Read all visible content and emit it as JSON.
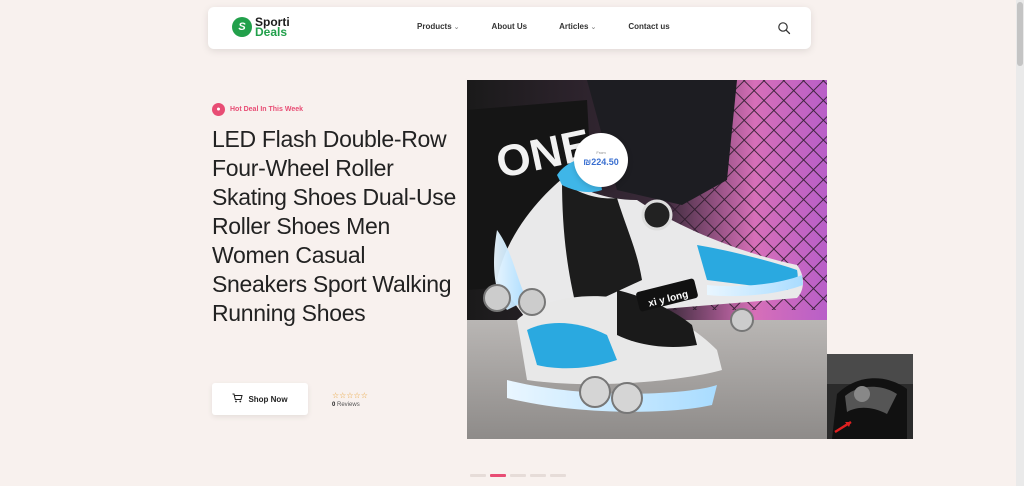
{
  "logo": {
    "line1": "Sporti",
    "line2": "Deals",
    "mark": "S"
  },
  "nav": {
    "items": [
      {
        "label": "Products",
        "dropdown": true
      },
      {
        "label": "About Us",
        "dropdown": false
      },
      {
        "label": "Articles",
        "dropdown": true
      },
      {
        "label": "Contact us",
        "dropdown": false
      }
    ],
    "search_icon": "search-icon"
  },
  "hero": {
    "badge": "Hot Deal In This Week",
    "badge_icon": "fire-icon",
    "title": "LED Flash Double-Row Four-Wheel Roller Skating Shoes Dual-Use Roller Shoes Men Women Casual Sneakers Sport Walking Running Shoes",
    "shop_button": "Shop Now",
    "cart_icon": "cart-icon",
    "stars": "☆☆☆☆☆",
    "review_count": "0",
    "review_label": "Reviews"
  },
  "price": {
    "from_label": "From",
    "amount": "₪224.50"
  },
  "slider": {
    "slide_count": 5,
    "active_index": 1
  },
  "colors": {
    "accent": "#e84d74",
    "brand_green": "#22a04b",
    "price_blue": "#3a6fd0",
    "background": "#f8f1ee"
  }
}
